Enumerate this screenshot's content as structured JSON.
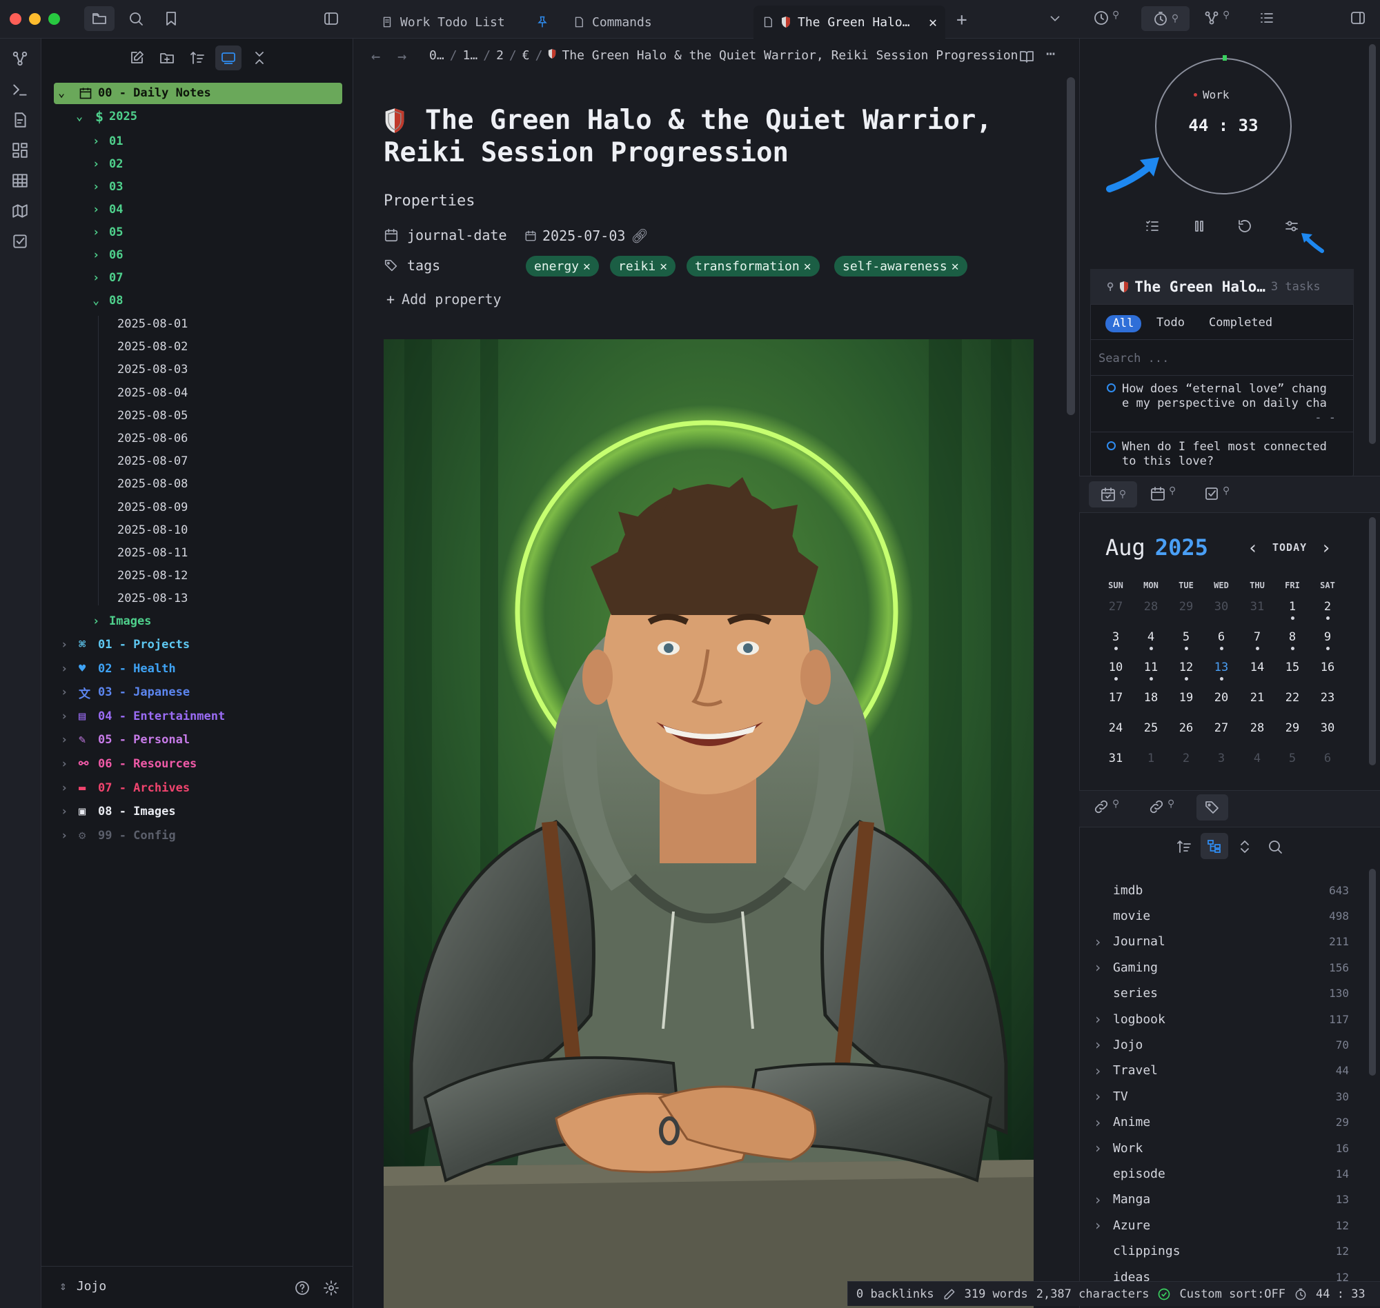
{
  "window": {
    "title": "The Green Halo & the Quiet Warrior, Reiki Session Progression"
  },
  "tabs": [
    {
      "label": "Work Todo List",
      "pinned": true
    },
    {
      "label": "Commands"
    },
    {
      "label": "The Green Halo…",
      "active": true
    }
  ],
  "breadcrumb": {
    "items": [
      "0…",
      "1…",
      "2",
      "€",
      "The Green Halo & the Quiet Warrior, Reiki Session Progression"
    ]
  },
  "sidebar": {
    "vault_name": "Jojo",
    "root_folder": "00 - Daily Notes",
    "year_folder": "2025",
    "month_folders": [
      "01",
      "02",
      "03",
      "04",
      "05",
      "06",
      "07",
      "08"
    ],
    "notes": [
      "2025-08-01",
      "2025-08-02",
      "2025-08-03",
      "2025-08-04",
      "2025-08-05",
      "2025-08-06",
      "2025-08-07",
      "2025-08-08",
      "2025-08-09",
      "2025-08-10",
      "2025-08-11",
      "2025-08-12",
      "2025-08-13"
    ],
    "images_folder": "Images",
    "folders": [
      {
        "label": "01 - Projects",
        "color": "#5ec8f2"
      },
      {
        "label": "02 - Health",
        "color": "#3fa3f5"
      },
      {
        "label": "03 - Japanese",
        "color": "#5c86f0"
      },
      {
        "label": "04 - Entertainment",
        "color": "#9b6cf5"
      },
      {
        "label": "05 - Personal",
        "color": "#c77be8"
      },
      {
        "label": "06 - Resources",
        "color": "#f05aa8"
      },
      {
        "label": "07 - Archives",
        "color": "#f0446e"
      },
      {
        "label": "08 - Images",
        "color": "#e8eaf0"
      },
      {
        "label": "99 - Config",
        "color": "#5b5f6b"
      }
    ]
  },
  "note": {
    "title_line1": "The Green Halo & the Quiet Warrior,",
    "title_line2": "Reiki Session Progression",
    "properties_label": "Properties",
    "prop_date_key": "journal-date",
    "prop_date_value": "2025-07-03",
    "prop_tags_key": "tags",
    "tags": [
      "energy",
      "reiki",
      "transformation",
      "self-awareness"
    ],
    "add_property": "Add property"
  },
  "pomodoro": {
    "mode": "Work",
    "time": "44 : 33"
  },
  "tasks": {
    "title": "The Green Halo…",
    "count": "3 tasks",
    "filters": [
      "All",
      "Todo",
      "Completed"
    ],
    "search_placeholder": "Search ...",
    "items": [
      {
        "line1": "How does “eternal love” chang",
        "line2": "e my perspective on daily cha",
        "line3": "- -"
      },
      {
        "line1": "When do I feel most connected",
        "line2": "to this love?",
        "line3": ""
      }
    ]
  },
  "calendar": {
    "month": "Aug",
    "year": "2025",
    "today_label": "TODAY",
    "weekdays": [
      "SUN",
      "MON",
      "TUE",
      "WED",
      "THU",
      "FRI",
      "SAT"
    ],
    "weeks": [
      [
        {
          "d": "27",
          "o": 1
        },
        {
          "d": "28",
          "o": 1
        },
        {
          "d": "29",
          "o": 1
        },
        {
          "d": "30",
          "o": 1
        },
        {
          "d": "31",
          "o": 1
        },
        {
          "d": "1",
          "dot": 1
        },
        {
          "d": "2",
          "dot": 1
        }
      ],
      [
        {
          "d": "3",
          "dot": 1
        },
        {
          "d": "4",
          "dot": 1
        },
        {
          "d": "5",
          "dot": 1
        },
        {
          "d": "6",
          "dot": 1
        },
        {
          "d": "7",
          "dot": 1
        },
        {
          "d": "8",
          "dot": 1
        },
        {
          "d": "9",
          "dot": 1
        }
      ],
      [
        {
          "d": "10",
          "dot": 1
        },
        {
          "d": "11",
          "dot": 1
        },
        {
          "d": "12",
          "dot": 1
        },
        {
          "d": "13",
          "dot": 1,
          "today": 1
        },
        {
          "d": "14"
        },
        {
          "d": "15"
        },
        {
          "d": "16"
        }
      ],
      [
        {
          "d": "17"
        },
        {
          "d": "18"
        },
        {
          "d": "19"
        },
        {
          "d": "20"
        },
        {
          "d": "21"
        },
        {
          "d": "22"
        },
        {
          "d": "23"
        }
      ],
      [
        {
          "d": "24"
        },
        {
          "d": "25"
        },
        {
          "d": "26"
        },
        {
          "d": "27"
        },
        {
          "d": "28"
        },
        {
          "d": "29"
        },
        {
          "d": "30"
        }
      ],
      [
        {
          "d": "31"
        },
        {
          "d": "1",
          "o": 1
        },
        {
          "d": "2",
          "o": 1
        },
        {
          "d": "3",
          "o": 1
        },
        {
          "d": "4",
          "o": 1
        },
        {
          "d": "5",
          "o": 1
        },
        {
          "d": "6",
          "o": 1
        }
      ]
    ]
  },
  "tag_pane": {
    "tags": [
      {
        "name": "imdb",
        "count": "643",
        "expandable": false
      },
      {
        "name": "movie",
        "count": "498",
        "expandable": false
      },
      {
        "name": "Journal",
        "count": "211",
        "expandable": true
      },
      {
        "name": "Gaming",
        "count": "156",
        "expandable": true
      },
      {
        "name": "series",
        "count": "130",
        "expandable": false
      },
      {
        "name": "logbook",
        "count": "117",
        "expandable": true
      },
      {
        "name": "Jojo",
        "count": "70",
        "expandable": true
      },
      {
        "name": "Travel",
        "count": "44",
        "expandable": true
      },
      {
        "name": "TV",
        "count": "30",
        "expandable": true
      },
      {
        "name": "Anime",
        "count": "29",
        "expandable": true
      },
      {
        "name": "Work",
        "count": "16",
        "expandable": true
      },
      {
        "name": "episode",
        "count": "14",
        "expandable": false
      },
      {
        "name": "Manga",
        "count": "13",
        "expandable": true
      },
      {
        "name": "Azure",
        "count": "12",
        "expandable": true
      },
      {
        "name": "clippings",
        "count": "12",
        "expandable": false
      },
      {
        "name": "ideas",
        "count": "12",
        "expandable": false
      }
    ]
  },
  "statusbar": {
    "backlinks": "0 backlinks",
    "words": "319 words",
    "characters": "2,387 characters",
    "sort": "Custom sort:OFF",
    "timer": "44 : 33"
  },
  "colors": {
    "accent": "#2f8cf0",
    "tag_bg": "#1b5e44",
    "folder_green": "#4fd08c",
    "highlight": "#6aa85a"
  }
}
